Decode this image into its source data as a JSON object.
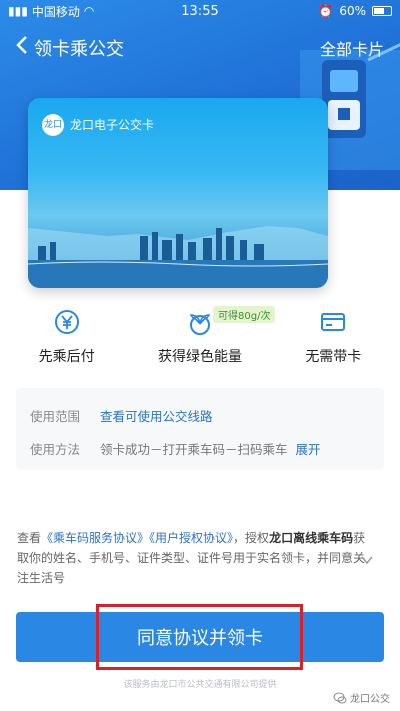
{
  "status_bar": {
    "carrier": "中国移动",
    "time": "13:55",
    "battery": "60%"
  },
  "nav": {
    "title": "领卡乘公交",
    "right": "全部卡片"
  },
  "card": {
    "name": "龙口电子公交卡",
    "logo_text": "龙口"
  },
  "features": [
    {
      "label": "先乘后付",
      "icon": "yen-icon"
    },
    {
      "label": "获得绿色能量",
      "icon": "sprout-icon",
      "tag": "可得80g/次"
    },
    {
      "label": "无需带卡",
      "icon": "card-icon"
    }
  ],
  "info": {
    "scope_label": "使用范围",
    "scope_link": "查看可使用公交线路",
    "method_label": "使用方法",
    "method_text": "领卡成功－打开乘车码－扫码乘车",
    "method_link": "展开"
  },
  "agreement": {
    "prefix": "查看",
    "link1": "《乘车码服务协议》",
    "link2": "《用户授权协议》",
    "mid": "，授权",
    "bold": "龙口离线乘车码",
    "suffix": "获取你的姓名、手机号、证件类型、证件号用于实名领卡，并同意关注生活号"
  },
  "button": {
    "label": "同意协议并领卡"
  },
  "footer": {
    "note": "该服务由龙口市公共交通有限公司提供",
    "watermark": "龙口公交"
  },
  "colors": {
    "primary": "#2a87e4",
    "link": "#2b73c4",
    "highlight": "#d4232a"
  }
}
